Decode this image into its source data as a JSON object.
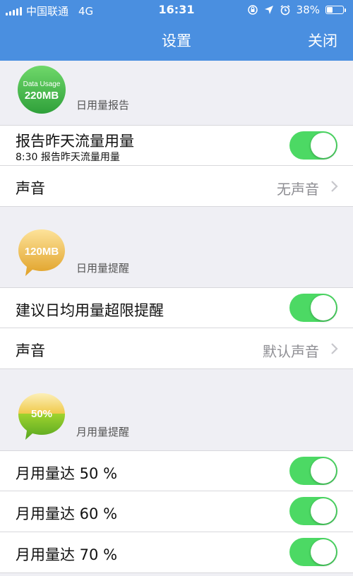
{
  "status_bar": {
    "carrier": "中国联通",
    "network": "4G",
    "time": "16:31",
    "battery": "38%",
    "battery_level": 0.38,
    "icons": [
      "signal-icon",
      "orientation-lock-icon",
      "location-icon",
      "alarm-icon",
      "battery-icon"
    ]
  },
  "nav": {
    "title": "设置",
    "close_label": "关闭"
  },
  "colors": {
    "nav_bg": "#4a8fe0",
    "toggle_on": "#4cd964",
    "page_bg": "#efeff4"
  },
  "daily_report": {
    "badge_top": "Data Usage",
    "badge_value": "220MB",
    "label": "日用量报告",
    "report_title": "报告昨天流量用量",
    "report_subtitle": "8:30 报告昨天流量用量",
    "report_on": true,
    "sound_label": "声音",
    "sound_value": "无声音"
  },
  "daily_alert": {
    "badge_value": "120MB",
    "label": "日用量提醒",
    "alert_title": "建议日均用量超限提醒",
    "alert_on": true,
    "sound_label": "声音",
    "sound_value": "默认声音"
  },
  "monthly_alert": {
    "badge_value": "50%",
    "label": "月用量提醒",
    "items": [
      {
        "label": "月用量达 50 %",
        "on": true
      },
      {
        "label": "月用量达 60 %",
        "on": true
      },
      {
        "label": "月用量达 70 %",
        "on": true
      }
    ]
  }
}
